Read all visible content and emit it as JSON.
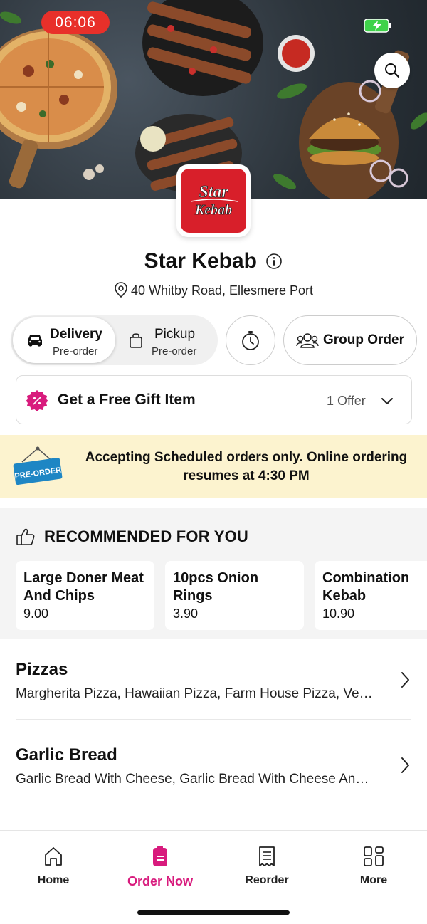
{
  "status_bar": {
    "time": "06:06"
  },
  "restaurant": {
    "name": "Star Kebab",
    "address": "40 Whitby Road, Ellesmere Port",
    "logo_line1": "Star",
    "logo_line2": "Kebab"
  },
  "order_mode": {
    "delivery_label": "Delivery",
    "delivery_sub": "Pre-order",
    "pickup_label": "Pickup",
    "pickup_sub": "Pre-order",
    "selected": "Delivery"
  },
  "group_order_label": "Group Order",
  "offer": {
    "title": "Get a Free Gift Item",
    "count": "1 Offer"
  },
  "banner": {
    "sign_text": "PRE-ORDER",
    "message": "Accepting Scheduled orders only. Online ordering resumes at 4:30 PM"
  },
  "recommended": {
    "title": "RECOMMENDED FOR YOU",
    "items": [
      {
        "name": "Large Doner Meat And Chips",
        "price": "9.00"
      },
      {
        "name": "10pcs Onion Rings",
        "price": "3.90"
      },
      {
        "name": "Combination Kebab",
        "price": "10.90"
      }
    ]
  },
  "categories": [
    {
      "title": "Pizzas",
      "desc": "Margherita Pizza, Hawaiian Pizza, Farm House Pizza, Vegetarian Pizza"
    },
    {
      "title": "Garlic Bread",
      "desc": "Garlic Bread With Cheese, Garlic Bread With Cheese And Tomato"
    }
  ],
  "bottom_nav": {
    "items": [
      {
        "label": "Home",
        "icon": "home-icon"
      },
      {
        "label": "Order Now",
        "icon": "order-now-icon"
      },
      {
        "label": "Reorder",
        "icon": "receipt-icon"
      },
      {
        "label": "More",
        "icon": "grid-icon"
      }
    ],
    "active": "Order Now"
  },
  "colors": {
    "accent": "#d81b7d",
    "time_pill": "#e8302a",
    "banner_bg": "#fcf3cf",
    "logo_red": "#d81f2a"
  }
}
